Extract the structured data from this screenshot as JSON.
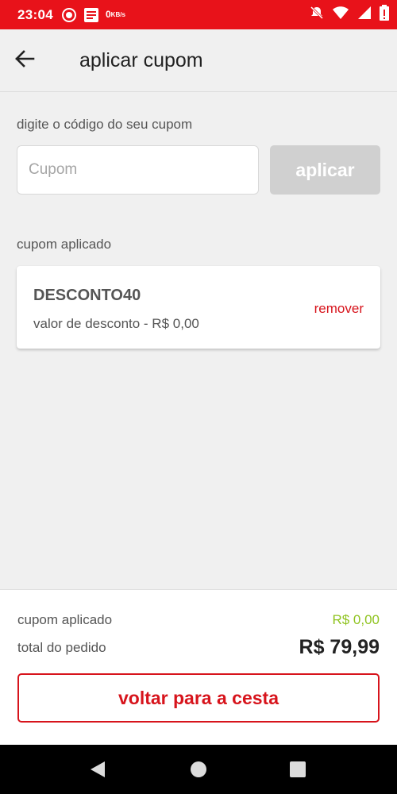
{
  "status_bar": {
    "time": "23:04",
    "speed_value": "0",
    "speed_unit": "KB/s",
    "icons": [
      "notification-circle-icon",
      "app-icon",
      "mute-icon",
      "wifi-icon",
      "signal-icon",
      "battery-icon"
    ]
  },
  "app_bar": {
    "back_icon": "arrow-left-icon",
    "title": "aplicar cupom"
  },
  "coupon_entry": {
    "label": "digite o código do seu cupom",
    "input_placeholder": "Cupom",
    "input_value": "",
    "apply_button": "aplicar"
  },
  "applied_coupon": {
    "section_label": "cupom aplicado",
    "code": "DESCONTO40",
    "discount_text": "valor de desconto - R$ 0,00",
    "remove_link": "remover"
  },
  "summary": {
    "coupon_label": "cupom aplicado",
    "coupon_value": "R$ 0,00",
    "total_label": "total do pedido",
    "total_value": "R$ 79,99",
    "back_button": "voltar para a cesta"
  },
  "colors": {
    "brand_red": "#e8121a",
    "accent_red": "#d7141c",
    "success_green": "#8fc31f",
    "disabled_gray": "#d0d0d0"
  },
  "nav_bar": {
    "icons": [
      "back-triangle-icon",
      "home-circle-icon",
      "recents-square-icon"
    ]
  }
}
